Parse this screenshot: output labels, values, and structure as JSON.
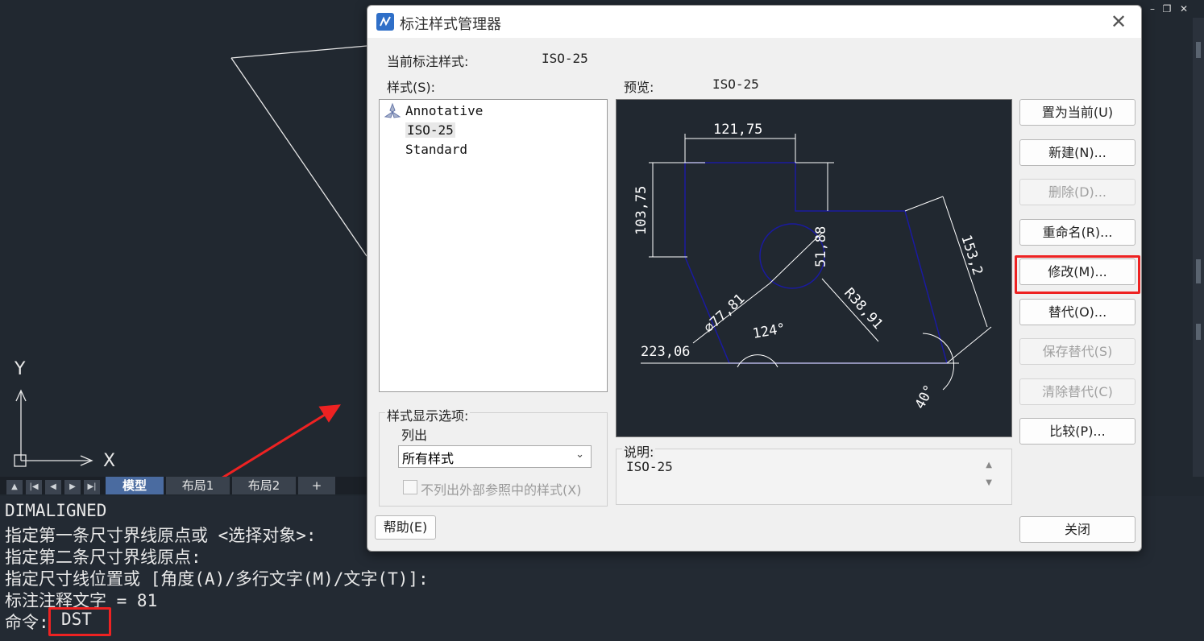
{
  "app": {
    "canvas": {
      "axis_x": "X",
      "axis_y": "Y"
    },
    "tabs": [
      "模型",
      "布局1",
      "布局2",
      "+"
    ],
    "active_tab": "模型",
    "command_history": [
      "DIMALIGNED",
      "指定第一条尺寸界线原点或 <选择对象>:",
      "指定第二条尺寸界线原点:",
      "指定尺寸线位置或 [角度(A)/多行文字(M)/文字(T)]:",
      "标注注释文字 = 81"
    ],
    "command_prompt": {
      "label": "命令:",
      "value": "DST"
    },
    "window_controls": [
      "–",
      "❐",
      "✕"
    ]
  },
  "dialog": {
    "title": "标注样式管理器",
    "current_style_label": "当前标注样式:",
    "current_style_value": "ISO-25",
    "styles_label": "样式(S):",
    "styles": [
      "Annotative",
      "ISO-25",
      "Standard"
    ],
    "selected_style": "ISO-25",
    "preview_label": "预览:",
    "preview_value": "ISO-25",
    "preview_dims": {
      "d1": "121,75",
      "d2": "103,75",
      "d3": "51,88",
      "d4": "153,2",
      "d5": "⌀77,81",
      "d6": "R38,91",
      "d7": "124°",
      "d8": "223,06",
      "d9": "40°"
    },
    "buttons": {
      "set_current": "置为当前(U)",
      "new": "新建(N)...",
      "delete": "删除(D)...",
      "rename": "重命名(R)...",
      "modify": "修改(M)...",
      "override": "替代(O)...",
      "save_override": "保存替代(S)",
      "clear_override": "清除替代(C)",
      "compare": "比较(P)...",
      "help": "帮助(E)",
      "close": "关闭"
    },
    "display_options_label": "样式显示选项:",
    "list_label": "列出",
    "list_value": "所有样式",
    "exclude_xref_label": "不列出外部参照中的样式(X)",
    "exclude_xref_checked": false,
    "description_label": "说明:",
    "description_value": "ISO-25"
  },
  "colors": {
    "highlight": "#ee2222",
    "canvas_bg": "#212830",
    "preview_line": "#1a1aa0"
  }
}
